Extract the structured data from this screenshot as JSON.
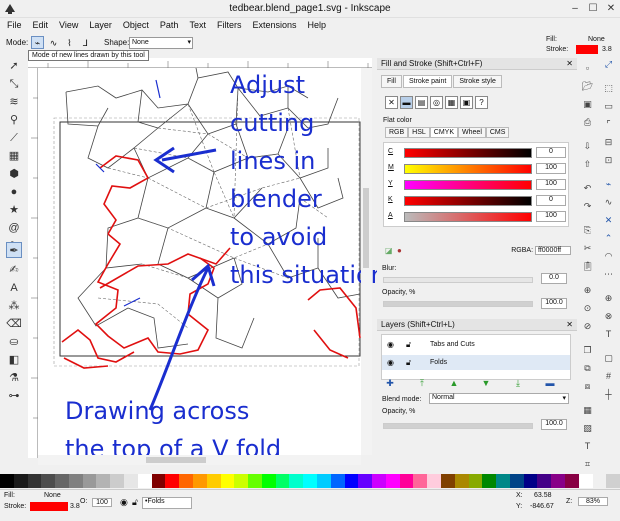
{
  "window": {
    "title": "tedbear.blend_page1.svg - Inkscape",
    "min": "–",
    "max": "☐",
    "close": "✕"
  },
  "menu": [
    "File",
    "Edit",
    "View",
    "Layer",
    "Object",
    "Path",
    "Text",
    "Filters",
    "Extensions",
    "Help"
  ],
  "toolctrl": {
    "mode_label": "Mode:",
    "shape_label": "Shape:",
    "shape_value": "None",
    "tooltip": "Mode of new lines drawn by this tool",
    "fill_label": "Fill:",
    "fill_value": "None",
    "stroke_label": "Stroke:",
    "stroke_width": "3.8",
    "stroke_color": "#ff0000"
  },
  "annotations": {
    "line1": "Adjust",
    "line2": "cutting",
    "line3": "lines in",
    "line4": "blender",
    "line5": "to avoid",
    "line6": "this situation",
    "line7": "Drawing across",
    "line8": "the top of a V fold",
    "color": "#1a2ecf"
  },
  "fill_stroke": {
    "title": "Fill and Stroke (Shift+Ctrl+F)",
    "tabs": [
      "Fill",
      "Stroke paint",
      "Stroke style"
    ],
    "flat_label": "Flat color",
    "models": [
      "RGB",
      "HSL",
      "CMYK",
      "Wheel",
      "CMS"
    ],
    "channels": [
      {
        "label": "C",
        "value": "0"
      },
      {
        "label": "M",
        "value": "100"
      },
      {
        "label": "Y",
        "value": "100"
      },
      {
        "label": "K",
        "value": "0"
      },
      {
        "label": "A",
        "value": "100"
      }
    ],
    "rgba_label": "RGBA:",
    "rgba_value": "ff0000ff",
    "blur_label": "Blur:",
    "blur_value": "0.0",
    "opacity_label": "Opacity, %",
    "opacity_value": "100.0"
  },
  "layers": {
    "title": "Layers (Shift+Ctrl+L)",
    "items": [
      "Tabs and Cuts",
      "Folds"
    ],
    "blend_label": "Blend mode:",
    "blend_value": "Normal",
    "opacity_label": "Opacity, %",
    "opacity_value": "100.0"
  },
  "status": {
    "fill_label": "Fill:",
    "fill_value": "None",
    "stroke_label": "Stroke:",
    "stroke_width": "3.8",
    "o_label": "O:",
    "o_value": "100",
    "layer_value": "•Folds",
    "x_label": "X:",
    "x_value": "63.58",
    "y_label": "Y:",
    "y_value": "-846.67",
    "z_label": "Z:",
    "zoom_value": "83%"
  },
  "palette_colors": [
    "#000000",
    "#1a1a1a",
    "#333333",
    "#4d4d4d",
    "#666666",
    "#808080",
    "#999999",
    "#b3b3b3",
    "#cccccc",
    "#e6e6e6",
    "#ffffff",
    "#800000",
    "#ff0000",
    "#ff6600",
    "#ff9900",
    "#ffcc00",
    "#ffff00",
    "#ccff00",
    "#66ff00",
    "#00ff00",
    "#00ff66",
    "#00ffcc",
    "#00ffff",
    "#00ccff",
    "#0066ff",
    "#0000ff",
    "#6600ff",
    "#cc00ff",
    "#ff00ff",
    "#ff0099",
    "#ff6699",
    "#ffccdd",
    "#804000",
    "#aa8800",
    "#88aa00",
    "#008800",
    "#008888",
    "#004488",
    "#000088",
    "#440088",
    "#880088",
    "#880044",
    "#ffffff",
    "#f0f0f0",
    "#d0d0d0"
  ]
}
